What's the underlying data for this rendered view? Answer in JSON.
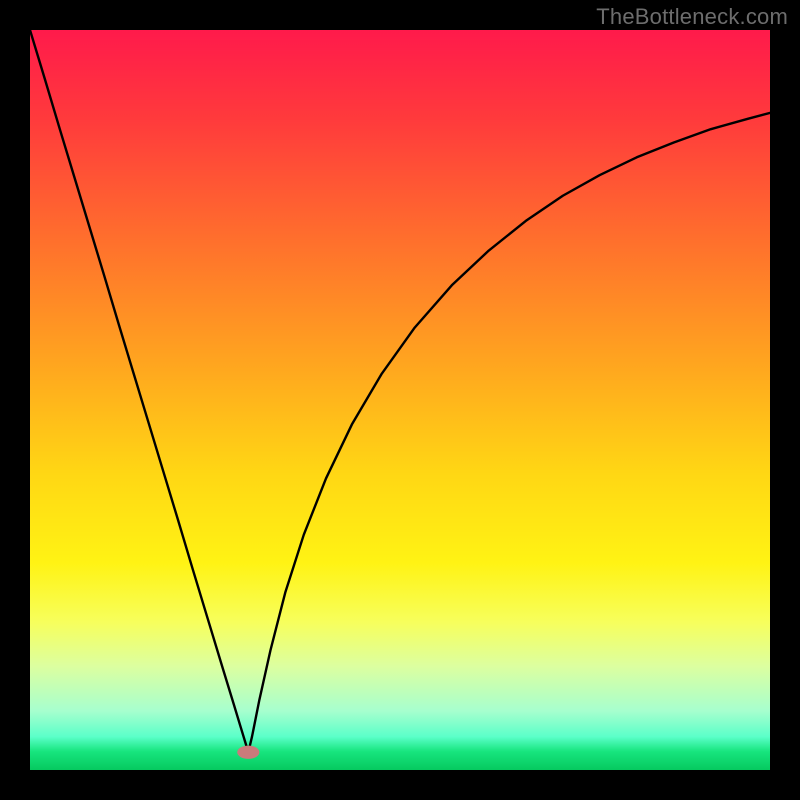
{
  "watermark": "TheBottleneck.com",
  "chart_data": {
    "type": "line",
    "title": "",
    "xlabel": "",
    "ylabel": "",
    "xlim": [
      0,
      1
    ],
    "ylim": [
      0,
      1
    ],
    "background_gradient": {
      "stops": [
        {
          "offset": 0.0,
          "color": "#ff1a4b"
        },
        {
          "offset": 0.12,
          "color": "#ff3a3c"
        },
        {
          "offset": 0.28,
          "color": "#ff6e2d"
        },
        {
          "offset": 0.45,
          "color": "#ffa51f"
        },
        {
          "offset": 0.6,
          "color": "#ffd714"
        },
        {
          "offset": 0.72,
          "color": "#fff314"
        },
        {
          "offset": 0.8,
          "color": "#f7ff5c"
        },
        {
          "offset": 0.86,
          "color": "#dcffa0"
        },
        {
          "offset": 0.92,
          "color": "#a7ffce"
        },
        {
          "offset": 0.955,
          "color": "#5bffc9"
        },
        {
          "offset": 0.975,
          "color": "#17e57e"
        },
        {
          "offset": 1.0,
          "color": "#06c95f"
        }
      ]
    },
    "minimum_marker": {
      "x": 0.295,
      "y": 0.976,
      "rx": 0.015,
      "ry": 0.009,
      "color": "#c97b7b"
    },
    "series": [
      {
        "name": "curve",
        "color": "#000000",
        "x": [
          0.0,
          0.02,
          0.04,
          0.06,
          0.08,
          0.1,
          0.12,
          0.14,
          0.16,
          0.18,
          0.2,
          0.22,
          0.24,
          0.26,
          0.275,
          0.285,
          0.292,
          0.295,
          0.3,
          0.31,
          0.325,
          0.345,
          0.37,
          0.4,
          0.435,
          0.475,
          0.52,
          0.57,
          0.62,
          0.67,
          0.72,
          0.77,
          0.82,
          0.87,
          0.92,
          0.97,
          1.0
        ],
        "y": [
          0.0,
          0.066,
          0.133,
          0.199,
          0.265,
          0.331,
          0.398,
          0.464,
          0.53,
          0.596,
          0.662,
          0.729,
          0.795,
          0.861,
          0.91,
          0.943,
          0.966,
          0.976,
          0.955,
          0.905,
          0.838,
          0.76,
          0.682,
          0.606,
          0.533,
          0.465,
          0.402,
          0.345,
          0.298,
          0.258,
          0.224,
          0.196,
          0.172,
          0.152,
          0.134,
          0.12,
          0.112
        ]
      }
    ]
  }
}
